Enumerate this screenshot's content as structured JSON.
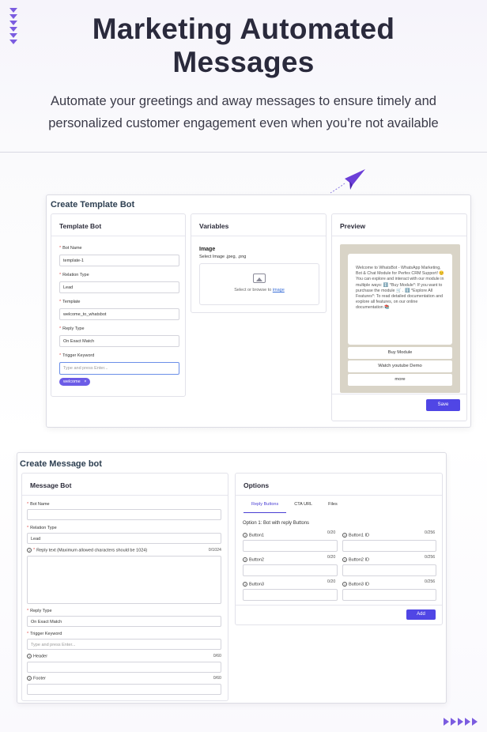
{
  "hero": {
    "title_line1": "Marketing Automated",
    "title_line2": "Messages",
    "subtitle": "Automate your greetings and away messages to ensure timely and personalized customer engagement even when you’re not available"
  },
  "template_bot": {
    "title": "Create Template Bot",
    "form_panel": {
      "heading": "Template Bot",
      "fields": {
        "bot_name": {
          "label": "Bot Name",
          "value": "template-1"
        },
        "relation_type": {
          "label": "Relation Type",
          "value": "Lead"
        },
        "template": {
          "label": "Template",
          "value": "welcome_to_whatsbot"
        },
        "reply_type": {
          "label": "Reply Type",
          "value": "On Exact Match"
        },
        "trigger_keyword": {
          "label": "Trigger Keyword",
          "placeholder": "Type and press Enter...",
          "tag": "welcome",
          "tag_remove": "×"
        }
      }
    },
    "variables_panel": {
      "heading": "Variables",
      "image_label": "Image",
      "image_hint": "Select Image .jpeg, .png",
      "upload_text": "Select or browse to",
      "upload_link": "image"
    },
    "preview_panel": {
      "heading": "Preview",
      "message": "Welcome to WhatsBot - WhatsApp Marketing, Bot & Chat Module for Perfex CRM Support! 😊 You can explore and interact with our module in multiple ways: ℹ️ *Buy Module*: If you want to purchase the module 🛒 . ℹ️ *Explore All Features*: To read detailed documentation and explore all features, on our online documentation 📚",
      "buttons": [
        "Buy Module",
        "Watch youtube Demo",
        "more"
      ],
      "save_label": "Save"
    }
  },
  "message_bot": {
    "title": "Create Message bot",
    "form_panel": {
      "heading": "Message Bot",
      "fields": {
        "bot_name": {
          "label": "Bot Name",
          "value": ""
        },
        "relation_type": {
          "label": "Relation Type",
          "value": "Lead"
        },
        "reply_text": {
          "label": "Reply text (Maximum allowed characters should be 1024)",
          "count": "0/1024",
          "value": ""
        },
        "reply_type": {
          "label": "Reply Type",
          "value": "On Exact Match"
        },
        "trigger_keyword": {
          "label": "Trigger Keyword",
          "placeholder": "Type and press Enter..."
        },
        "header": {
          "label": "Header",
          "count": "0/60",
          "value": ""
        },
        "footer": {
          "label": "Footer",
          "count": "0/60",
          "value": ""
        }
      }
    },
    "options_panel": {
      "heading": "Options",
      "tabs": [
        "Reply Buttons",
        "CTA URL",
        "Files"
      ],
      "option_title": "Option 1: Bot with reply Buttons",
      "buttons": [
        {
          "label": "Button1",
          "count": "0/20",
          "id_label": "Button1 ID",
          "id_count": "0/256"
        },
        {
          "label": "Button2",
          "count": "0/20",
          "id_label": "Button2 ID",
          "id_count": "0/256"
        },
        {
          "label": "Button3",
          "count": "0/20",
          "id_label": "Button3 ID",
          "id_count": "0/256"
        }
      ],
      "add_label": "Add"
    }
  },
  "colors": {
    "accent": "#5046e5",
    "tag": "#6c5ce7",
    "required": "#e04c4c",
    "decor": "#7b5ce0"
  }
}
